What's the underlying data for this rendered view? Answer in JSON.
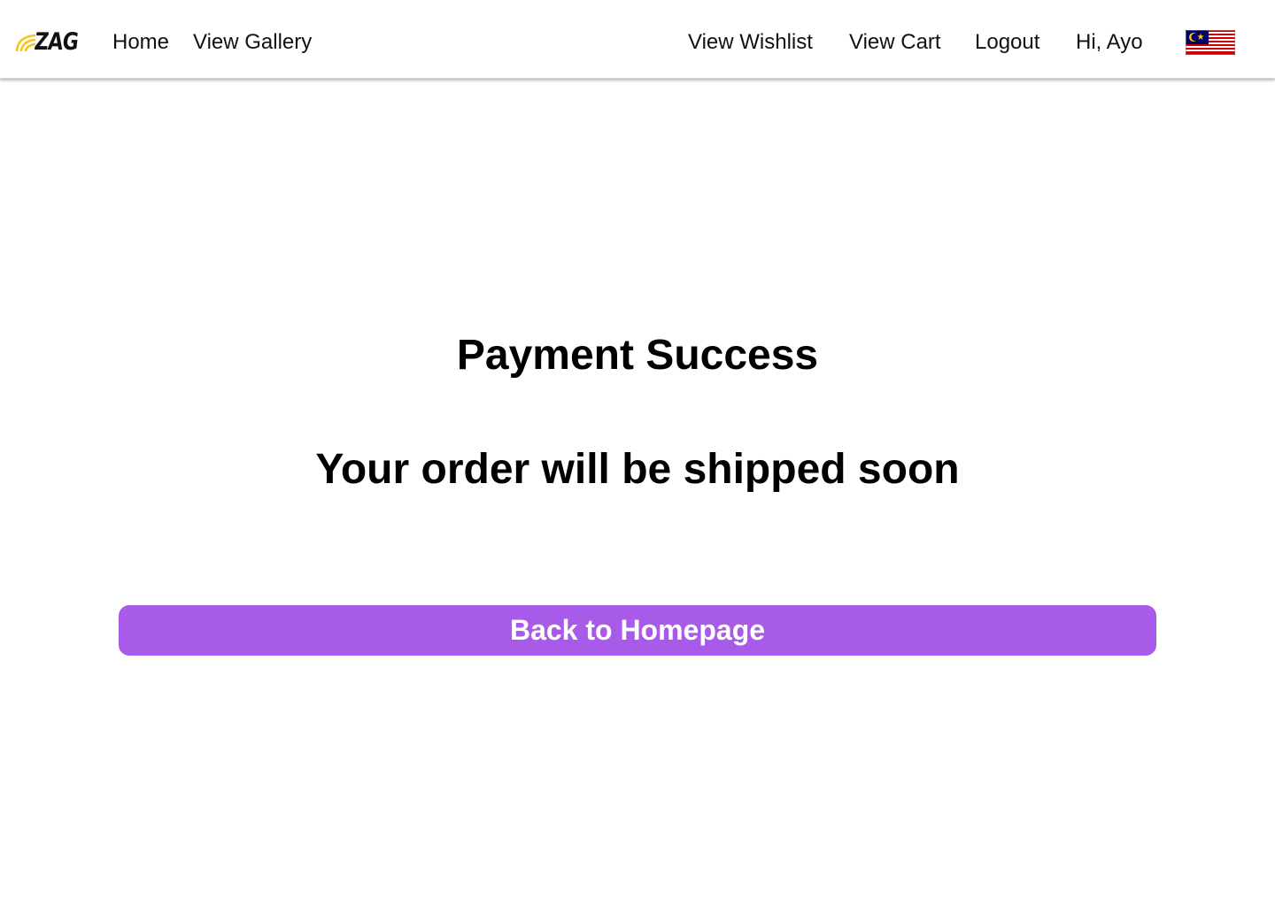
{
  "brand": {
    "name": "ZAG",
    "accent_color": "#F5C518"
  },
  "nav": {
    "home": "Home",
    "gallery": "View Gallery",
    "wishlist": "View Wishlist",
    "cart": "View Cart",
    "logout": "Logout",
    "greeting": "Hi, Ayo",
    "language_icon": "malaysia-flag-icon"
  },
  "content": {
    "title": "Payment Success",
    "subtitle": "Your order will be shipped soon"
  },
  "actions": {
    "back_home_label": "Back to Homepage",
    "button_color": "#A75BE8"
  }
}
